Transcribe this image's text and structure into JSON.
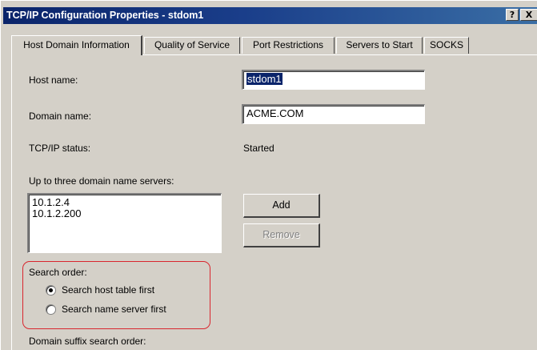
{
  "window": {
    "title": "TCP/IP Configuration Properties - stdom1",
    "help_label": "?",
    "close_label": "X"
  },
  "tabs": [
    {
      "label": "Host Domain Information",
      "active": true
    },
    {
      "label": "Quality of Service",
      "active": false
    },
    {
      "label": "Port Restrictions",
      "active": false
    },
    {
      "label": "Servers to Start",
      "active": false
    },
    {
      "label": "SOCKS",
      "active": false
    }
  ],
  "host": {
    "label": "Host name:",
    "value": "stdom1"
  },
  "domain": {
    "label": "Domain name:",
    "value": "ACME.COM"
  },
  "status": {
    "label": "TCP/IP status:",
    "value": "Started"
  },
  "dns": {
    "label": "Up to three domain name servers:",
    "servers": [
      "10.1.2.4",
      "10.1.2.200"
    ],
    "add_label": "Add",
    "remove_label": "Remove"
  },
  "search_order": {
    "label": "Search order:",
    "options": [
      {
        "label": "Search host table first",
        "selected": true
      },
      {
        "label": "Search name server first",
        "selected": false
      }
    ]
  },
  "suffix": {
    "label": "Domain suffix search order:"
  },
  "colors": {
    "titlebar": "#0a246a",
    "face": "#d4d0c8",
    "highlight_outline": "#d9262e"
  }
}
